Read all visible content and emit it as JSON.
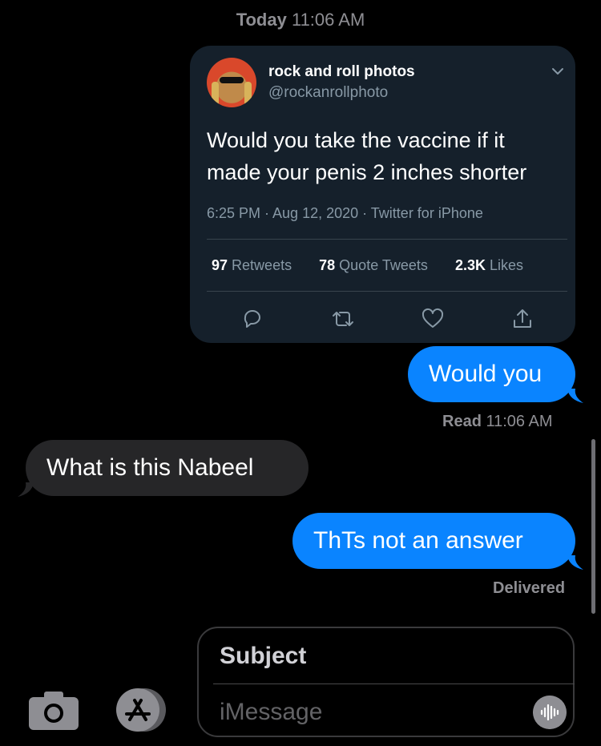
{
  "header": {
    "timestamp_bold": "Today",
    "timestamp_time": "11:06 AM"
  },
  "tweet": {
    "name": "rock and roll photos",
    "handle": "@rockanrollphoto",
    "text": "Would you take the vaccine if it made your penis 2 inches shorter",
    "meta": "6:25 PM · Aug 12, 2020 · Twitter for iPhone",
    "retweets_count": "97",
    "retweets_label": "Retweets",
    "quotes_count": "78",
    "quotes_label": "Quote Tweets",
    "likes_count": "2.3K",
    "likes_label": "Likes"
  },
  "messages": [
    {
      "direction": "outgoing",
      "text": "Would you"
    },
    {
      "direction": "incoming",
      "text": "What is this Nabeel"
    },
    {
      "direction": "outgoing",
      "text": "ThTs not an answer"
    }
  ],
  "receipts": {
    "read_label": "Read",
    "read_time": "11:06 AM",
    "delivered": "Delivered"
  },
  "compose": {
    "subject_placeholder": "Subject",
    "message_placeholder": "iMessage"
  },
  "icons": [
    "camera-icon",
    "app-store-icon",
    "audio-waveform-icon",
    "reply-icon",
    "retweet-icon",
    "like-icon",
    "share-icon",
    "chevron-down-icon"
  ],
  "colors": {
    "outgoing_bubble": "#0a84ff",
    "incoming_bubble": "#262628",
    "tweet_background": "#15202b"
  }
}
